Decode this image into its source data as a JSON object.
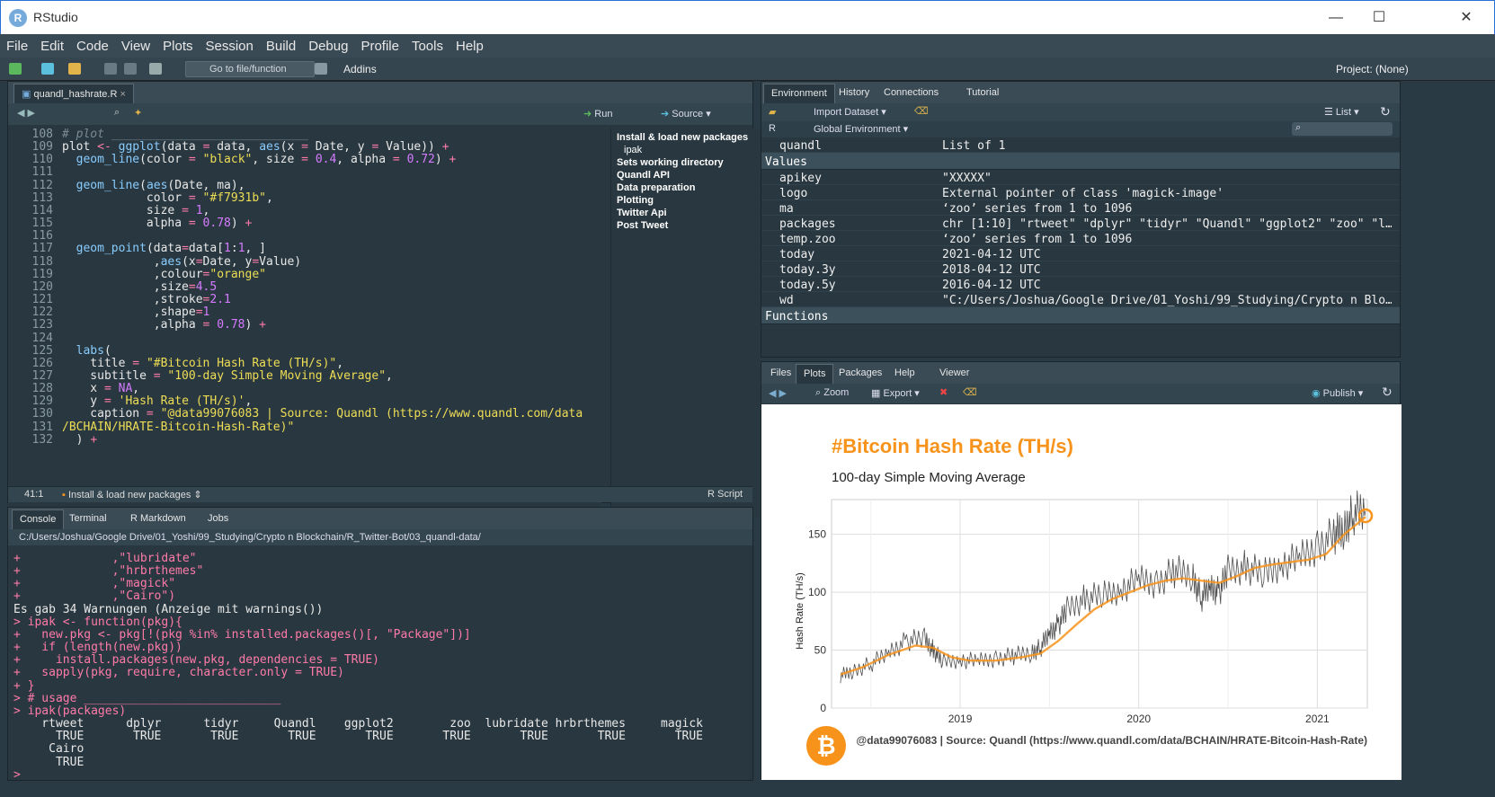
{
  "window": {
    "title": "RStudio",
    "min": "—",
    "max": "☐",
    "close": "✕"
  },
  "menu": [
    "File",
    "Edit",
    "Code",
    "View",
    "Plots",
    "Session",
    "Build",
    "Debug",
    "Profile",
    "Tools",
    "Help"
  ],
  "toolbar": {
    "goto_placeholder": "Go to file/function",
    "addins": "Addins",
    "project": "Project: (None)"
  },
  "editor": {
    "tab": "quandl_hashrate.R",
    "run": "Run",
    "source": "Source",
    "line_numbers": [
      "108",
      "109",
      "110",
      "111",
      "112",
      "113",
      "114",
      "115",
      "116",
      "117",
      "118",
      "119",
      "120",
      "121",
      "122",
      "123",
      "124",
      "125",
      "126",
      "127",
      "128",
      "129",
      "130",
      "",
      "131",
      "132"
    ],
    "cursor": "41:1",
    "section": "Install & load new packages",
    "filetype": "R Script",
    "outline": [
      "Install & load new packages",
      "ipak",
      "Sets working directory",
      "Quandl API",
      "Data preparation",
      "Plotting",
      "Twitter Api",
      "Post Tweet"
    ]
  },
  "console": {
    "tabs": [
      "Console",
      "Terminal",
      "R Markdown",
      "Jobs"
    ],
    "path": "C:/Users/Joshua/Google Drive/01_Yoshi/99_Studying/Crypto n Blockchain/R_Twitter-Bot/03_quandl-data/",
    "lines": [
      {
        "p": "+",
        "t": "            ,\"lubridate\"",
        "c": "prompt"
      },
      {
        "p": "+",
        "t": "            ,\"hrbrthemes\"",
        "c": "prompt"
      },
      {
        "p": "+",
        "t": "            ,\"magick\"",
        "c": "prompt"
      },
      {
        "p": "+",
        "t": "            ,\"Cairo\")",
        "c": "prompt"
      },
      {
        "p": "",
        "t": "Es gab 34 Warnungen (Anzeige mit warnings())",
        "c": "out"
      },
      {
        "p": ">",
        "t": "ipak <- function(pkg){",
        "c": "prompt"
      },
      {
        "p": "+",
        "t": "  new.pkg <- pkg[!(pkg %in% installed.packages()[, \"Package\"])]",
        "c": "prompt"
      },
      {
        "p": "+",
        "t": "  if (length(new.pkg))",
        "c": "prompt"
      },
      {
        "p": "+",
        "t": "    install.packages(new.pkg, dependencies = TRUE)",
        "c": "prompt"
      },
      {
        "p": "+",
        "t": "  sapply(pkg, require, character.only = TRUE)",
        "c": "prompt"
      },
      {
        "p": "+",
        "t": "}",
        "c": "prompt"
      },
      {
        "p": ">",
        "t": "# usage ____________________________",
        "c": "prompt"
      },
      {
        "p": ">",
        "t": "ipak(packages)",
        "c": "prompt"
      },
      {
        "p": "",
        "t": "    rtweet      dplyr      tidyr     Quandl    ggplot2        zoo  lubridate hrbrthemes     magick",
        "c": "out"
      },
      {
        "p": "",
        "t": "      TRUE       TRUE       TRUE       TRUE       TRUE       TRUE       TRUE       TRUE       TRUE",
        "c": "out"
      },
      {
        "p": "",
        "t": "     Cairo",
        "c": "out"
      },
      {
        "p": "",
        "t": "      TRUE",
        "c": "out"
      },
      {
        "p": ">",
        "t": "",
        "c": "prompt"
      }
    ]
  },
  "environment": {
    "tabs": [
      "Environment",
      "History",
      "Connections",
      "Tutorial"
    ],
    "import": "Import Dataset",
    "list": "List",
    "lang": "R",
    "scope": "Global Environment",
    "top_row": {
      "k": "quandl",
      "v": "List of  1"
    },
    "values_header": "Values",
    "functions_header": "Functions",
    "rows": [
      {
        "k": "apikey",
        "v": "\"XXXXX\""
      },
      {
        "k": "logo",
        "v": "External pointer of class 'magick-image'"
      },
      {
        "k": "ma",
        "v": "‘zoo’ series from 1 to 1096"
      },
      {
        "k": "packages",
        "v": "chr [1:10] \"rtweet\" \"dplyr\" \"tidyr\" \"Quandl\" \"ggplot2\" \"zoo\" \"l…"
      },
      {
        "k": "temp.zoo",
        "v": "‘zoo’ series from 1 to 1096"
      },
      {
        "k": "today",
        "v": "2021-04-12 UTC"
      },
      {
        "k": "today.3y",
        "v": "2018-04-12 UTC"
      },
      {
        "k": "today.5y",
        "v": "2016-04-12 UTC"
      },
      {
        "k": "wd",
        "v": "\"C:/Users/Joshua/Google Drive/01_Yoshi/99_Studying/Crypto n Blo…"
      }
    ]
  },
  "files": {
    "tabs": [
      "Files",
      "Plots",
      "Packages",
      "Help",
      "Viewer"
    ],
    "zoom": "Zoom",
    "export": "Export",
    "publish": "Publish"
  },
  "chart_data": {
    "type": "line",
    "title": "#Bitcoin Hash Rate (TH/s)",
    "subtitle": "100-day Simple Moving Average",
    "xlabel": "",
    "ylabel": "Hash Rate (TH/s)",
    "caption": "@data99076083 | Source: Quandl (https://www.quandl.com/data/BCHAIN/HRATE-Bitcoin-Hash-Rate)",
    "x_ticks": [
      "2019",
      "2020",
      "2021"
    ],
    "y_ticks": [
      0,
      50,
      100,
      150
    ],
    "xlim": [
      2018.28,
      2021.28
    ],
    "ylim": [
      0,
      180
    ],
    "grid": true,
    "series": [
      {
        "color": "#222222",
        "x": [
          2018.33,
          2018.4,
          2018.5,
          2018.6,
          2018.7,
          2018.8,
          2018.85,
          2018.9,
          2019.0,
          2019.1,
          2019.2,
          2019.3,
          2019.4,
          2019.45,
          2019.5,
          2019.55,
          2019.6,
          2019.7,
          2019.8,
          2019.9,
          2020.0,
          2020.1,
          2020.2,
          2020.3,
          2020.35,
          2020.4,
          2020.45,
          2020.5,
          2020.6,
          2020.7,
          2020.8,
          2020.9,
          2021.0,
          2021.1,
          2021.15,
          2021.2,
          2021.27
        ],
        "y": [
          28,
          32,
          38,
          48,
          58,
          60,
          50,
          40,
          42,
          40,
          43,
          45,
          48,
          52,
          65,
          72,
          85,
          95,
          97,
          103,
          110,
          108,
          118,
          115,
          95,
          105,
          100,
          118,
          122,
          115,
          125,
          128,
          140,
          150,
          155,
          168,
          170
        ]
      },
      {
        "color": "#f7931b",
        "x": [
          2018.33,
          2018.45,
          2018.6,
          2018.75,
          2018.85,
          2018.95,
          2019.05,
          2019.2,
          2019.35,
          2019.45,
          2019.55,
          2019.65,
          2019.75,
          2019.85,
          2019.95,
          2020.05,
          2020.15,
          2020.25,
          2020.35,
          2020.45,
          2020.55,
          2020.65,
          2020.75,
          2020.85,
          2020.95,
          2021.05,
          2021.15,
          2021.27
        ],
        "y": [
          29,
          35,
          46,
          54,
          52,
          44,
          41,
          41,
          44,
          47,
          58,
          72,
          85,
          94,
          100,
          106,
          110,
          112,
          110,
          108,
          114,
          121,
          124,
          126,
          128,
          133,
          150,
          165
        ]
      }
    ]
  },
  "colors": {
    "accent": "#f7931b",
    "bg": "#293840"
  }
}
